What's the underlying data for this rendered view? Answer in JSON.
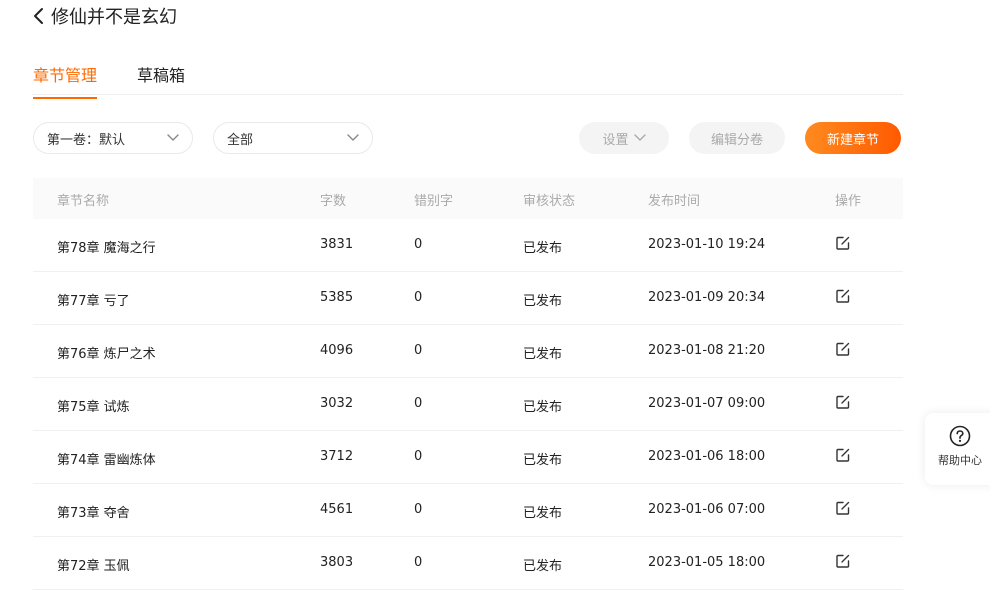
{
  "header": {
    "back_icon": "chevron-left-icon",
    "book_title": "修仙并不是玄幻"
  },
  "tabs": [
    {
      "label": "章节管理",
      "active": true
    },
    {
      "label": "草稿箱",
      "active": false
    }
  ],
  "toolbar": {
    "volume_select": "第一卷：默认",
    "status_select": "全部",
    "settings_label": "设置",
    "edit_volume_label": "编辑分卷",
    "new_chapter_label": "新建章节"
  },
  "table": {
    "headers": [
      "章节名称",
      "字数",
      "错别字",
      "审核状态",
      "发布时间",
      "操作"
    ],
    "rows": [
      {
        "title": "第78章 魔海之行",
        "words": "3831",
        "typos": "0",
        "status": "已发布",
        "time": "2023-01-10 19:24"
      },
      {
        "title": "第77章 亏了",
        "words": "5385",
        "typos": "0",
        "status": "已发布",
        "time": "2023-01-09 20:34"
      },
      {
        "title": "第76章 炼尸之术",
        "words": "4096",
        "typos": "0",
        "status": "已发布",
        "time": "2023-01-08 21:20"
      },
      {
        "title": "第75章 试炼",
        "words": "3032",
        "typos": "0",
        "status": "已发布",
        "time": "2023-01-07 09:00"
      },
      {
        "title": "第74章 雷幽炼体",
        "words": "3712",
        "typos": "0",
        "status": "已发布",
        "time": "2023-01-06 18:00"
      },
      {
        "title": "第73章 夺舍",
        "words": "4561",
        "typos": "0",
        "status": "已发布",
        "time": "2023-01-06 07:00"
      },
      {
        "title": "第72章 玉佩",
        "words": "3803",
        "typos": "0",
        "status": "已发布",
        "time": "2023-01-05 18:00"
      }
    ],
    "op_icon": "edit-icon"
  },
  "help": {
    "icon": "question-circle-icon",
    "label": "帮助中心"
  },
  "colors": {
    "accent": "#ff6a00",
    "muted_text": "#aaaaaa",
    "header_bg": "#fafafa"
  }
}
